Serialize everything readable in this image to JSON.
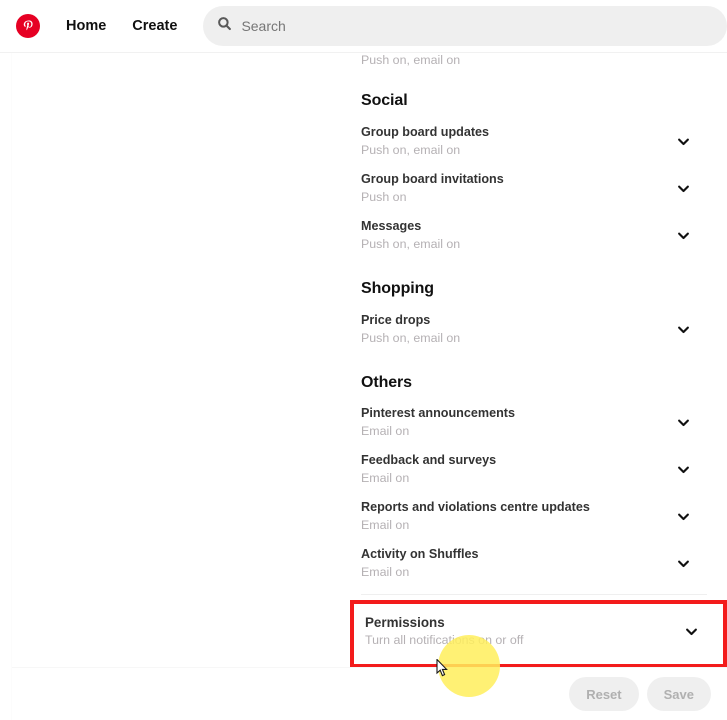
{
  "header": {
    "logo_icon": "pinterest-logo-icon",
    "nav": [
      {
        "label": "Home"
      },
      {
        "label": "Create"
      }
    ],
    "search": {
      "icon": "search-icon",
      "value": "",
      "placeholder": "Search"
    }
  },
  "settings": {
    "cut_off_row": {
      "subtitle": "Push on, email on"
    },
    "sections": [
      {
        "title": "Social",
        "rows": [
          {
            "title": "Group board updates",
            "subtitle": "Push on, email on",
            "chevron": "chevron-down-icon"
          },
          {
            "title": "Group board invitations",
            "subtitle": "Push on",
            "chevron": "chevron-down-icon"
          },
          {
            "title": "Messages",
            "subtitle": "Push on, email on",
            "chevron": "chevron-down-icon"
          }
        ]
      },
      {
        "title": "Shopping",
        "rows": [
          {
            "title": "Price drops",
            "subtitle": "Push on, email on",
            "chevron": "chevron-down-icon"
          }
        ]
      },
      {
        "title": "Others",
        "rows": [
          {
            "title": "Pinterest announcements",
            "subtitle": "Email on",
            "chevron": "chevron-down-icon"
          },
          {
            "title": "Feedback and surveys",
            "subtitle": "Email on",
            "chevron": "chevron-down-icon"
          },
          {
            "title": "Reports and violations centre updates",
            "subtitle": "Email on",
            "chevron": "chevron-down-icon"
          },
          {
            "title": "Activity on Shuffles",
            "subtitle": "Email on",
            "chevron": "chevron-down-icon"
          }
        ]
      }
    ],
    "permissions": {
      "title": "Permissions",
      "subtitle": "Turn all notifications on or off",
      "chevron": "chevron-down-icon",
      "highlight_color": "#f31b1b"
    }
  },
  "footer": {
    "reset_label": "Reset",
    "save_label": "Save"
  },
  "colors": {
    "brand_red": "#e60023",
    "highlight_red": "#f31b1b",
    "click_halo_yellow": "#ffef5c",
    "text_primary": "#111111",
    "text_row_title": "#333333",
    "text_muted": "#b5b1b4",
    "search_bg": "#efefef"
  }
}
